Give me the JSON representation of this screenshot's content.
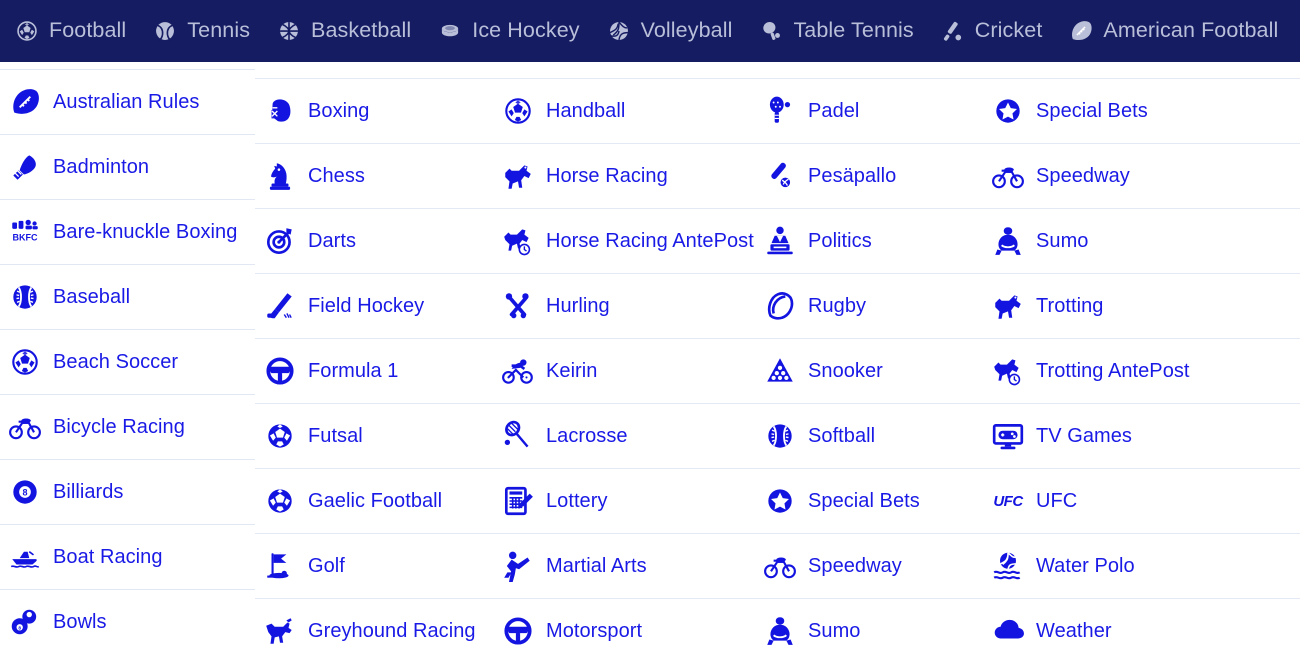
{
  "colors": {
    "nav_bg": "#151c61",
    "nav_text": "#b9bfd9",
    "link_blue": "#1a1ae6",
    "icon_blue": "#1414e0",
    "divider": "#e3e9f5",
    "page_bg": "#ffffff"
  },
  "nav": {
    "items": [
      {
        "label": "Football",
        "icon": "football-icon"
      },
      {
        "label": "Tennis",
        "icon": "tennis-ball-icon"
      },
      {
        "label": "Basketball",
        "icon": "basketball-icon"
      },
      {
        "label": "Ice Hockey",
        "icon": "hockey-puck-icon"
      },
      {
        "label": "Volleyball",
        "icon": "volleyball-icon"
      },
      {
        "label": "Table Tennis",
        "icon": "table-tennis-paddle-icon"
      },
      {
        "label": "Cricket",
        "icon": "cricket-bat-icon"
      },
      {
        "label": "American Football",
        "icon": "american-football-icon"
      }
    ]
  },
  "grid": {
    "columns": [
      {
        "name": "column-1",
        "items": [
          {
            "label": "Australian Rules",
            "icon": "australian-football-icon"
          },
          {
            "label": "Badminton",
            "icon": "shuttlecock-icon"
          },
          {
            "label": "Bare-knuckle Boxing",
            "icon": "bkfc-logo-icon"
          },
          {
            "label": "Baseball",
            "icon": "baseball-icon"
          },
          {
            "label": "Beach Soccer",
            "icon": "beach-soccer-icon"
          },
          {
            "label": "Bicycle Racing",
            "icon": "bicycle-icon"
          },
          {
            "label": "Billiards",
            "icon": "eight-ball-icon"
          },
          {
            "label": "Boat Racing",
            "icon": "speedboat-icon"
          },
          {
            "label": "Bowls",
            "icon": "bowls-balls-icon"
          }
        ]
      },
      {
        "name": "column-2",
        "items": [
          {
            "label": "Boxing",
            "icon": "boxing-glove-icon"
          },
          {
            "label": "Chess",
            "icon": "chess-knight-icon"
          },
          {
            "label": "Darts",
            "icon": "dartboard-icon"
          },
          {
            "label": "Field Hockey",
            "icon": "field-hockey-stick-icon"
          },
          {
            "label": "Formula 1",
            "icon": "steering-wheel-icon"
          },
          {
            "label": "Futsal",
            "icon": "futsal-ball-icon"
          },
          {
            "label": "Gaelic Football",
            "icon": "gaelic-football-icon"
          },
          {
            "label": "Golf",
            "icon": "golf-flag-icon"
          },
          {
            "label": "Greyhound Racing",
            "icon": "greyhound-icon"
          }
        ]
      },
      {
        "name": "column-3",
        "items": [
          {
            "label": "Handball",
            "icon": "handball-icon"
          },
          {
            "label": "Horse Racing",
            "icon": "horse-icon"
          },
          {
            "label": "Horse Racing AntePost",
            "icon": "horse-clock-icon"
          },
          {
            "label": "Hurling",
            "icon": "hurling-sticks-icon"
          },
          {
            "label": "Keirin",
            "icon": "keirin-cyclist-icon"
          },
          {
            "label": "Lacrosse",
            "icon": "lacrosse-stick-icon"
          },
          {
            "label": "Lottery",
            "icon": "lottery-ticket-icon"
          },
          {
            "label": "Martial Arts",
            "icon": "martial-arts-kick-icon"
          },
          {
            "label": "Motorsport",
            "icon": "steering-wheel-icon"
          }
        ]
      },
      {
        "name": "column-4",
        "items": [
          {
            "label": "Padel",
            "icon": "padel-racket-icon"
          },
          {
            "label": "Pesäpallo",
            "icon": "pesapallo-bat-icon"
          },
          {
            "label": "Politics",
            "icon": "politician-podium-icon"
          },
          {
            "label": "Rugby",
            "icon": "rugby-ball-icon"
          },
          {
            "label": "Snooker",
            "icon": "snooker-triangle-icon"
          },
          {
            "label": "Softball",
            "icon": "softball-icon"
          },
          {
            "label": "Special Bets",
            "icon": "star-circle-icon"
          },
          {
            "label": "Speedway",
            "icon": "speedway-motorcycle-icon"
          },
          {
            "label": "Sumo",
            "icon": "sumo-wrestler-icon"
          }
        ]
      },
      {
        "name": "column-5",
        "items": [
          {
            "label": "Special Bets",
            "icon": "star-circle-icon"
          },
          {
            "label": "Speedway",
            "icon": "speedway-motorcycle-icon"
          },
          {
            "label": "Sumo",
            "icon": "sumo-wrestler-icon"
          },
          {
            "label": "Trotting",
            "icon": "trotting-horse-icon"
          },
          {
            "label": "Trotting AntePost",
            "icon": "trotting-horse-clock-icon"
          },
          {
            "label": "TV Games",
            "icon": "tv-gamepad-icon"
          },
          {
            "label": "UFC",
            "icon": "ufc-logo-icon"
          },
          {
            "label": "Water Polo",
            "icon": "water-polo-icon"
          },
          {
            "label": "Weather",
            "icon": "cloud-icon"
          }
        ]
      }
    ]
  }
}
